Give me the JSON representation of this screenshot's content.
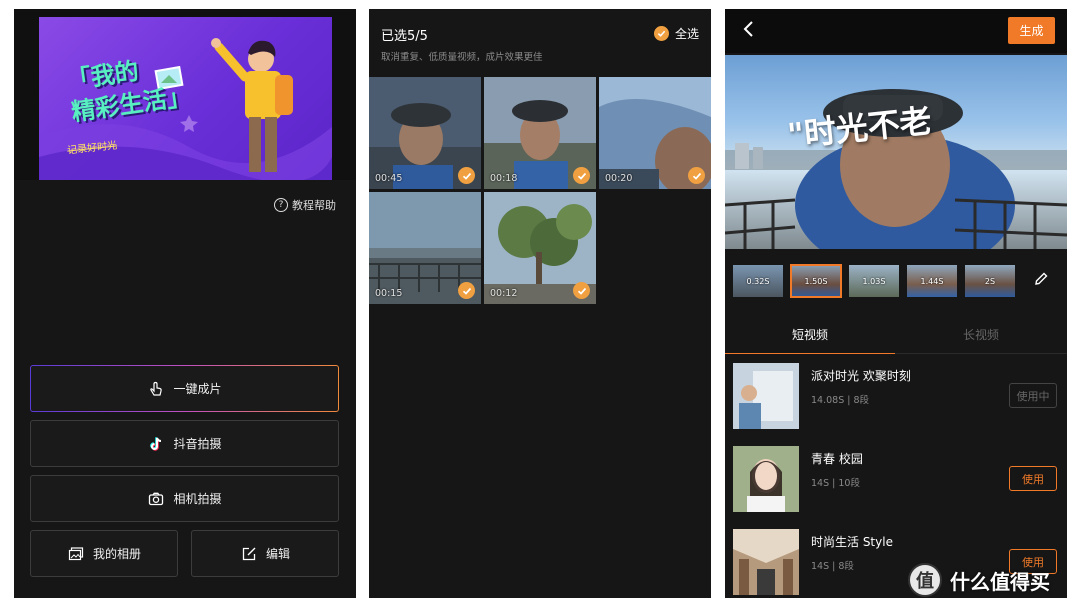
{
  "panel_a": {
    "banner": {
      "title_line1": "「我的",
      "title_line2": "精彩生活」",
      "subtitle": "记录好时光"
    },
    "help_label": "教程帮助",
    "buttons": {
      "one_key": "一键成片",
      "douyin": "抖音拍摄",
      "camera": "相机拍摄",
      "album": "我的相册",
      "edit": "编辑"
    },
    "icons": [
      "hand-tap-icon",
      "tiktok-icon",
      "camera-icon",
      "album-icon",
      "edit-icon",
      "help-icon"
    ]
  },
  "panel_b": {
    "title": "已选5/5",
    "hint": "取消重复、低质量视频，成片效果更佳",
    "select_all": "全选",
    "thumbs": [
      {
        "duration": "00:45"
      },
      {
        "duration": "00:18"
      },
      {
        "duration": "00:20"
      },
      {
        "duration": "00:15"
      },
      {
        "duration": "00:12"
      }
    ]
  },
  "panel_c": {
    "generate": "生成",
    "overlay_text": "\"时光不老",
    "clips": [
      "0.32S",
      "1.50S",
      "1.03S",
      "1.44S",
      "2S"
    ],
    "tabs": {
      "short": "短视频",
      "long": "长视频"
    },
    "templates": [
      {
        "name": "派对时光 欢聚时刻",
        "meta": "14.08S | 8段",
        "action": "使用中",
        "state": "using"
      },
      {
        "name": "青春 校园",
        "meta": "14S | 10段",
        "action": "使用",
        "state": "ready"
      },
      {
        "name": "时尚生活 Style",
        "meta": "14S | 8段",
        "action": "使用",
        "state": "ready"
      }
    ]
  },
  "watermark": {
    "logo": "值",
    "text": "什么值得买"
  },
  "colors": {
    "accent": "#f07a28",
    "check": "#f0a040",
    "background": "#161616"
  }
}
